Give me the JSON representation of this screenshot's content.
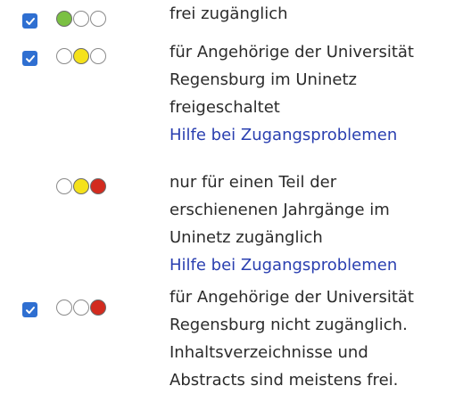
{
  "rows": [
    {
      "lights": [
        "green",
        "off",
        "off"
      ],
      "checked": true,
      "lines": [
        "frei zugänglich"
      ],
      "link": null
    },
    {
      "lights": [
        "off",
        "yellow",
        "off"
      ],
      "checked": true,
      "lines": [
        "für Angehörige der Universität",
        "Regensburg im Uninetz",
        "freigeschaltet"
      ],
      "link": "Hilfe bei Zugangsproblemen"
    },
    {
      "lights": [
        "off",
        "yellow",
        "red"
      ],
      "checked": false,
      "lines": [
        "nur für einen Teil der",
        "erschienenen Jahrgänge im",
        "Uninetz zugänglich"
      ],
      "link": "Hilfe bei Zugangsproblemen"
    },
    {
      "lights": [
        "off",
        "off",
        "red"
      ],
      "checked": true,
      "lines": [
        "für Angehörige der Universität",
        "Regensburg nicht zugänglich.",
        "Inhaltsverzeichnisse und",
        "Abstracts sind meistens frei."
      ],
      "link": null
    }
  ],
  "colors": {
    "green": "#7bc043",
    "yellow": "#f5e21b",
    "red": "#d22b1f",
    "checkbox": "#2f6fd1",
    "link": "#2a3fb0",
    "text": "#2b2b2b"
  }
}
